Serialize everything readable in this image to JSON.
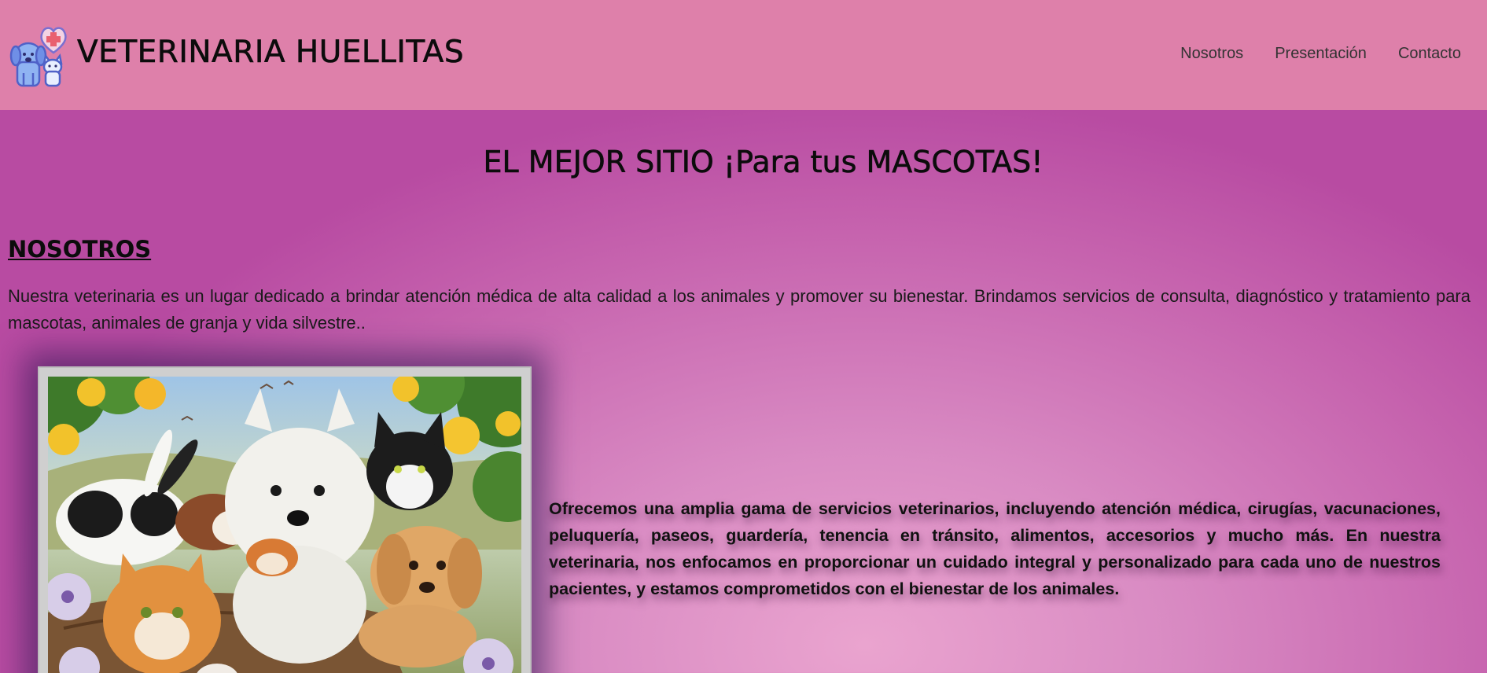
{
  "header": {
    "brand": "VETERINARIA HUELLITAS",
    "logo_icon": "pets-heart-cross-logo-icon",
    "nav": [
      {
        "label": "Nosotros"
      },
      {
        "label": "Presentación"
      },
      {
        "label": "Contacto"
      }
    ]
  },
  "hero": {
    "title": "EL MEJOR SITIO ¡Para tus MASCOTAS!"
  },
  "about": {
    "heading": "NOSOTROS",
    "intro": "Nuestra veterinaria es un lugar dedicado a brindar atención médica de alta calidad a los animales y promover su bienestar. Brindamos servicios de consulta, diagnóstico y tratamiento para mascotas, animales de granja y vida silvestre..",
    "services": "Ofrecemos una amplia gama de servicios veterinarios, incluyendo atención médica, cirugías, vacunaciones, peluquería, paseos, guardería, tenencia en tránsito, alimentos, accesorios y mucho más. En nuestra veterinaria, nos enfocamos en proporcionar un cuidado integral y personalizado para cada uno de nuestros pacientes, y estamos comprometidos con el bienestar de los animales.",
    "image_icon": "pets-group-illustration"
  },
  "colors": {
    "header_bg": "#de80aa",
    "page_bg_edge": "#b84ba2",
    "page_bg_center": "#eaa4cf",
    "text": "#0c0c0c"
  }
}
